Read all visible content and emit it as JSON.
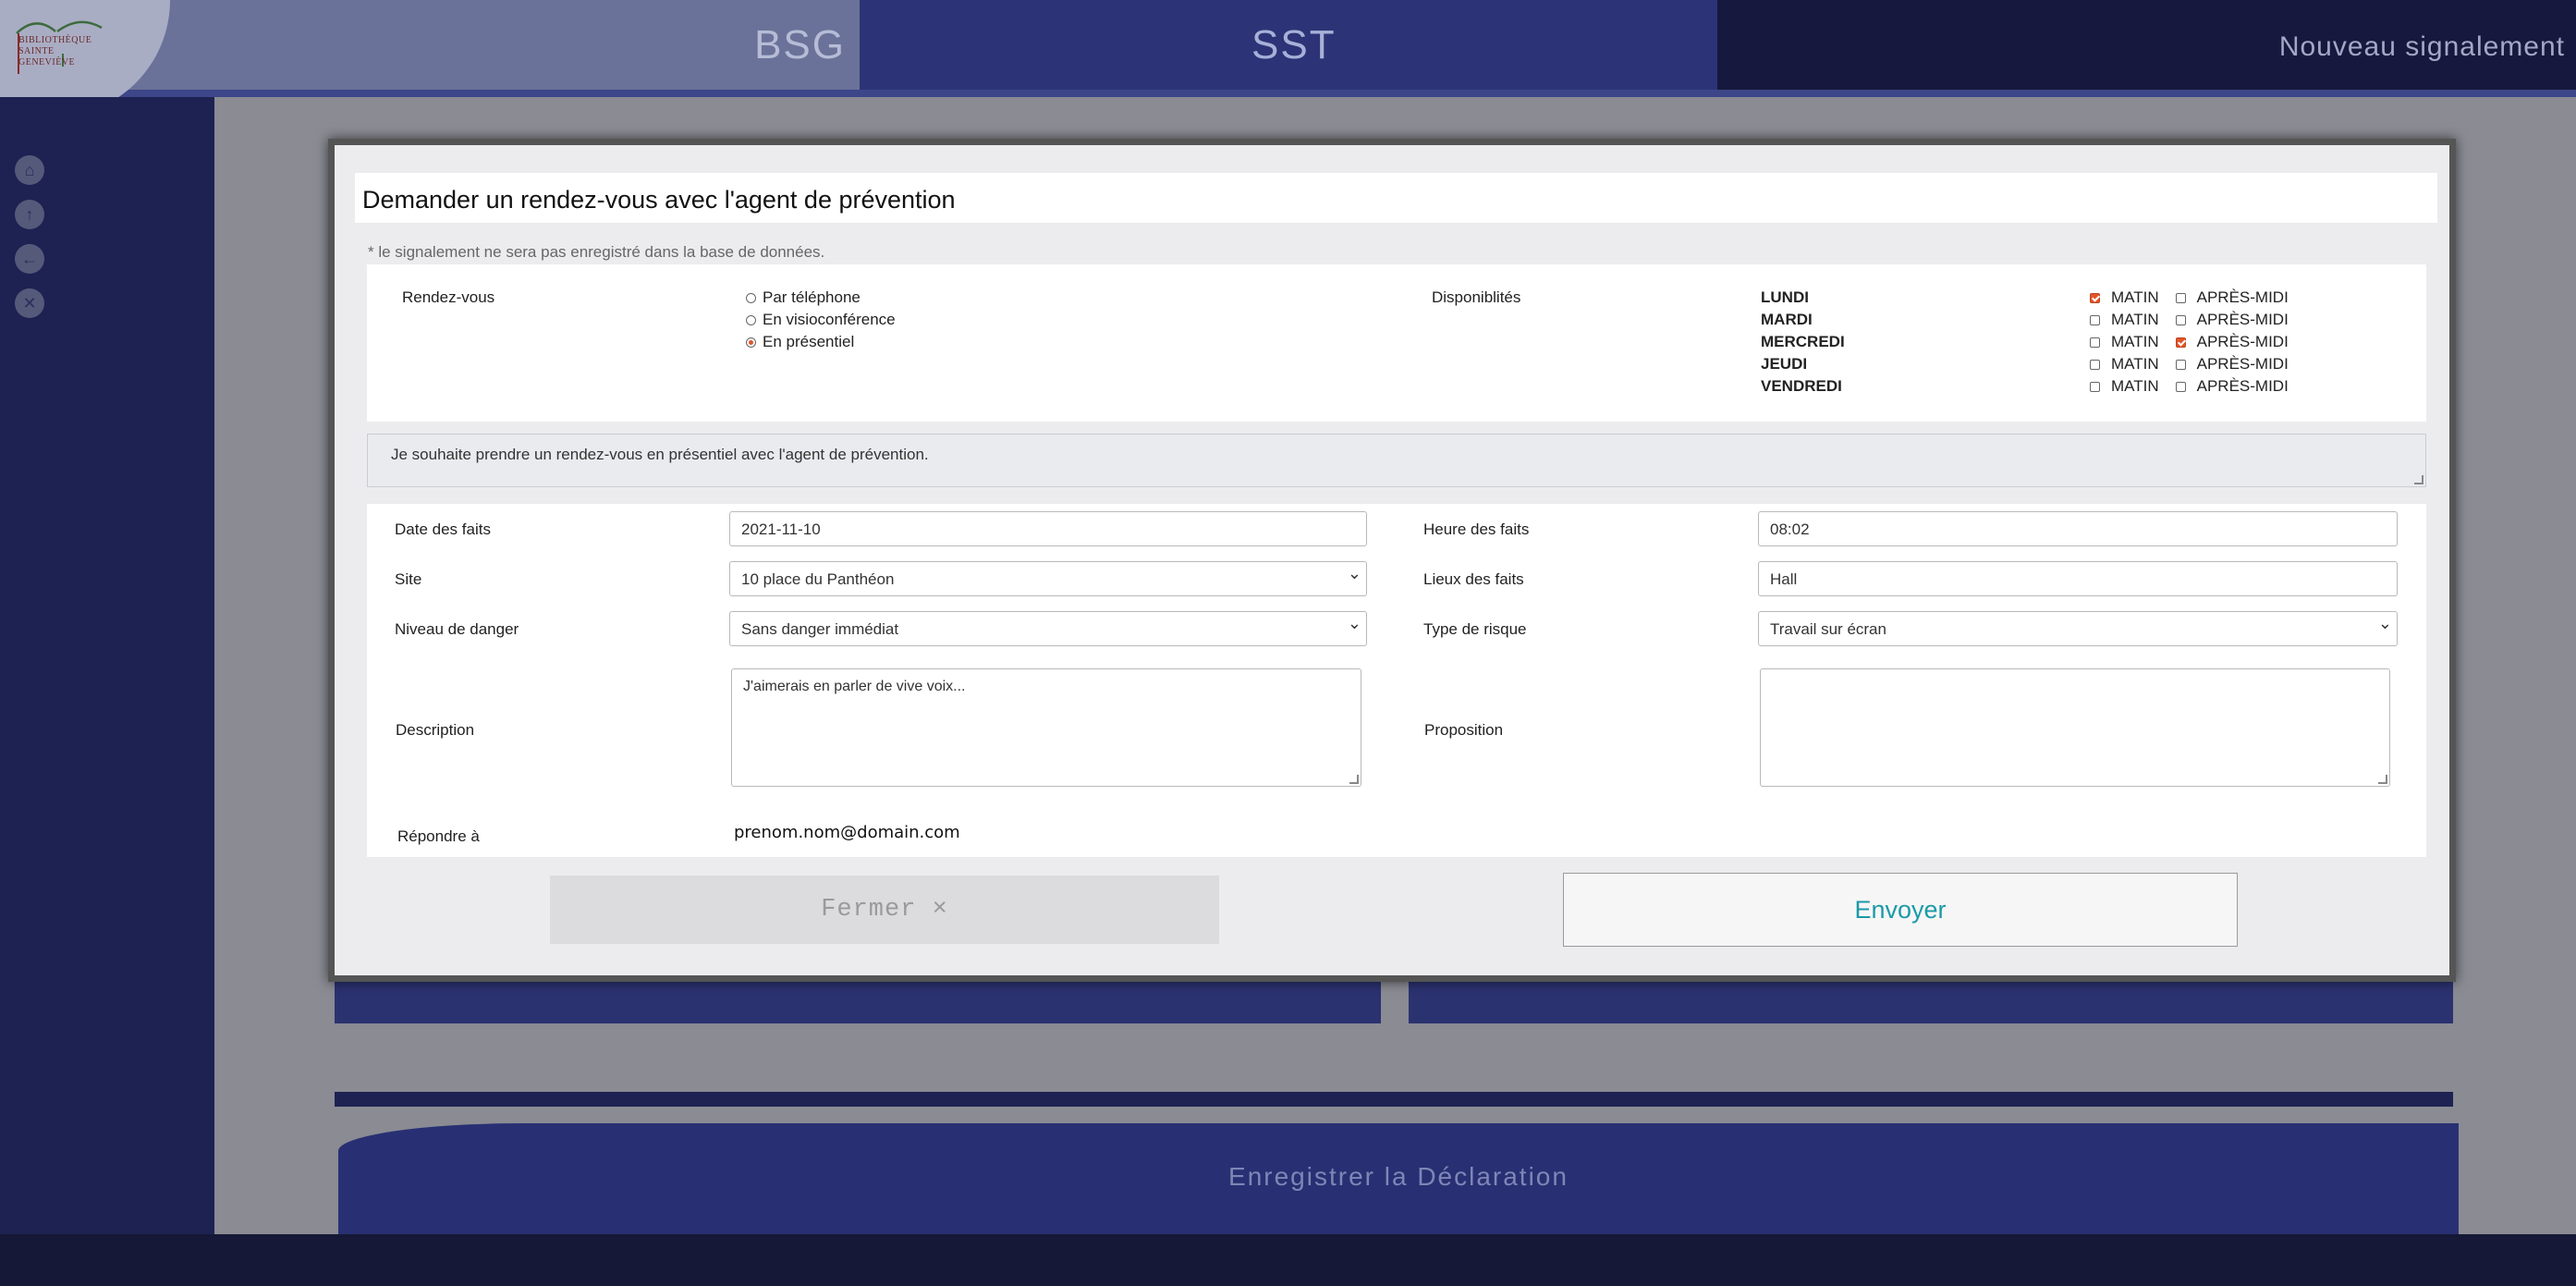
{
  "app": {
    "logo_text": [
      "BIBLIOTHÈQUE",
      "SAINTE",
      "GENEVIÈVE"
    ],
    "nav": {
      "bsg": "BSG",
      "sst": "SST",
      "new_report": "Nouveau signalement"
    },
    "sidebar_icons": [
      "home-icon",
      "upload-icon",
      "back-icon",
      "close-icon"
    ],
    "save_declaration": "Enregistrer la Déclaration"
  },
  "modal": {
    "title": "Demander un rendez-vous avec l'agent de prévention",
    "notice": "* le signalement ne sera pas enregistré dans la base de données.",
    "rdv_label": "Rendez-vous",
    "rdv_options": [
      {
        "label": "Par téléphone",
        "selected": false
      },
      {
        "label": "En visioconférence",
        "selected": false
      },
      {
        "label": "En présentiel",
        "selected": true
      }
    ],
    "dispo_label": "Disponiblités",
    "morning_label": "MATIN",
    "afternoon_label": "APRÈS-MIDI",
    "days": [
      {
        "day": "LUNDI",
        "matin": true,
        "apres_midi": false
      },
      {
        "day": "MARDI",
        "matin": false,
        "apres_midi": false
      },
      {
        "day": "MERCREDI",
        "matin": false,
        "apres_midi": true
      },
      {
        "day": "JEUDI",
        "matin": false,
        "apres_midi": false
      },
      {
        "day": "VENDREDI",
        "matin": false,
        "apres_midi": false
      }
    ],
    "message": "Je souhaite prendre un rendez-vous en présentiel avec l'agent de prévention.",
    "form": {
      "date_label": "Date des faits",
      "date_value": "2021-11-10",
      "heure_label": "Heure des faits",
      "heure_value": "08:02",
      "site_label": "Site",
      "site_value": "10 place du Panthéon",
      "lieux_label": "Lieux des faits",
      "lieux_value": "Hall",
      "danger_label": "Niveau de danger",
      "danger_value": "Sans danger immédiat",
      "risque_label": "Type de risque",
      "risque_value": "Travail sur écran",
      "description_label": "Description",
      "description_value": "J'aimerais en parler de vive voix...",
      "proposition_label": "Proposition",
      "proposition_value": "",
      "reply_label": "Répondre à",
      "reply_value": "prenom.nom@domain.com"
    },
    "close_button": "Fermer ×",
    "send_button": "Envoyer"
  },
  "colors": {
    "accent": "#e0552a",
    "send_text": "#1b9aa8",
    "navy": "#1c2051"
  }
}
